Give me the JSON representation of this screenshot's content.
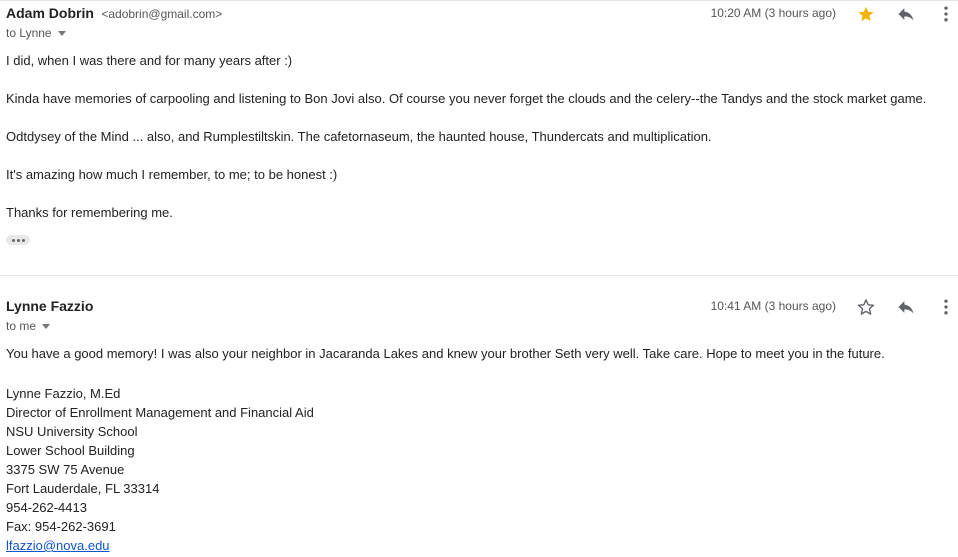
{
  "messages": [
    {
      "sender_name": "Adam Dobrin",
      "sender_email": "<adobrin@gmail.com>",
      "to_label": "to Lynne",
      "time": "10:20 AM (3 hours ago)",
      "starred": true,
      "paragraphs": [
        "I did, when I was there and for many years after :)",
        "Kinda have memories of carpooling and listening to Bon Jovi also.  Of course you never forget the clouds and the celery--the Tandys and the stock market game.",
        "Odtdysey of the Mind ... also, and Rumplestiltskin.  The cafetornaseum, the haunted house, Thundercats and multiplication.",
        "It's amazing how much I remember, to me; to be honest :)",
        "Thanks for remembering me."
      ],
      "icons": {
        "star": "star-filled-icon",
        "reply": "reply-icon",
        "more": "more-vert-icon",
        "expand": "ellipsis-icon"
      }
    },
    {
      "sender_name": "Lynne Fazzio",
      "to_label": "to me",
      "time": "10:41 AM (3 hours ago)",
      "starred": false,
      "paragraphs": [
        "You have a good memory! I was also your neighbor in Jacaranda Lakes and knew your brother Seth very well. Take care. Hope to meet you in the future."
      ],
      "signature": [
        "Lynne Fazzio, M.Ed",
        "Director of Enrollment Management and Financial Aid",
        "NSU University School",
        "Lower School Building",
        "3375 SW 75 Avenue",
        "Fort Lauderdale, FL 33314",
        "954-262-4413",
        "Fax: 954-262-3691"
      ],
      "signature_email": "lfazzio@nova.edu",
      "icons": {
        "star": "star-outline-icon",
        "reply": "reply-icon",
        "more": "more-vert-icon"
      }
    }
  ],
  "colors": {
    "star_filled": "#f4b400",
    "icon": "#5f6368",
    "link": "#1155cc"
  }
}
